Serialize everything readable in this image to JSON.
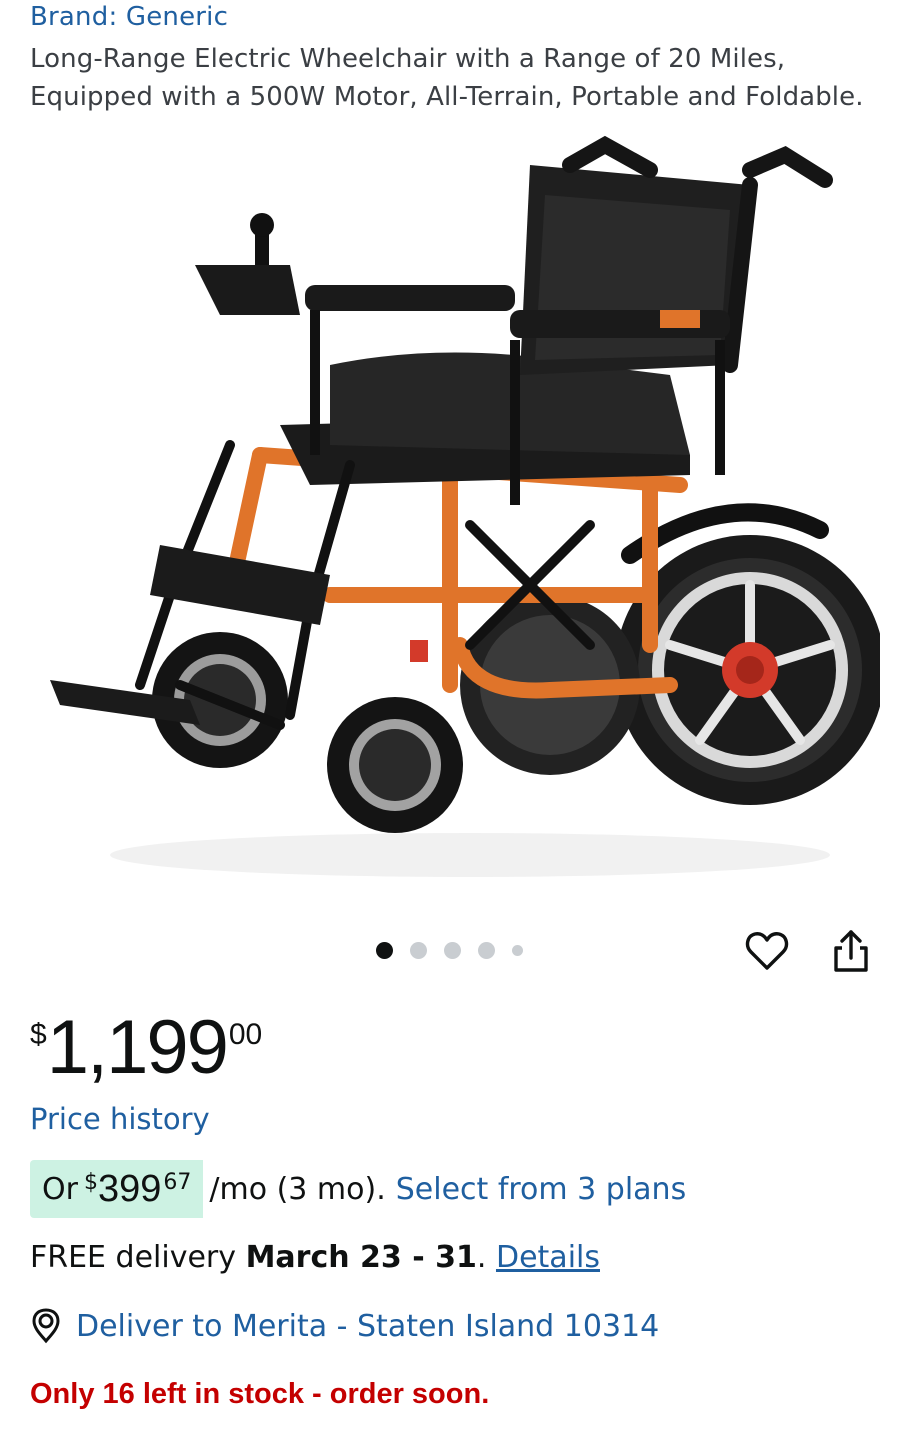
{
  "product": {
    "brand": "Brand: Generic",
    "title_line1": "Long-Range Electric Wheelchair with a Range of 20 Miles,",
    "title_line2": "Equipped with a 500W Motor, All-Terrain, Portable and Foldable.",
    "image_icon": "wheelchair-product-image"
  },
  "carousel": {
    "total_dots": 5,
    "active_index": 0
  },
  "actions": {
    "favorite_icon": "heart-icon",
    "share_icon": "share-icon"
  },
  "price": {
    "symbol": "$",
    "whole": "1,199",
    "fraction": "00",
    "history_link": "Price history"
  },
  "installment": {
    "prefix": "Or",
    "symbol": "$",
    "amount": "399",
    "cents": "67",
    "terms": "/mo (3 mo).",
    "link": "Select from 3 plans"
  },
  "delivery": {
    "prefix": "FREE delivery",
    "dates": "March 23 - 31",
    "suffix": ".",
    "details_link": "Details"
  },
  "location": {
    "icon": "location-pin-icon",
    "text": "Deliver to Merita - Staten Island 10314"
  },
  "stock": {
    "text": "Only 16 left in stock - order soon."
  },
  "colors": {
    "link": "#1f5fa0",
    "stock_red": "#c40000",
    "installment_bg": "#cdf2e3",
    "frame_orange": "#e0742a"
  }
}
